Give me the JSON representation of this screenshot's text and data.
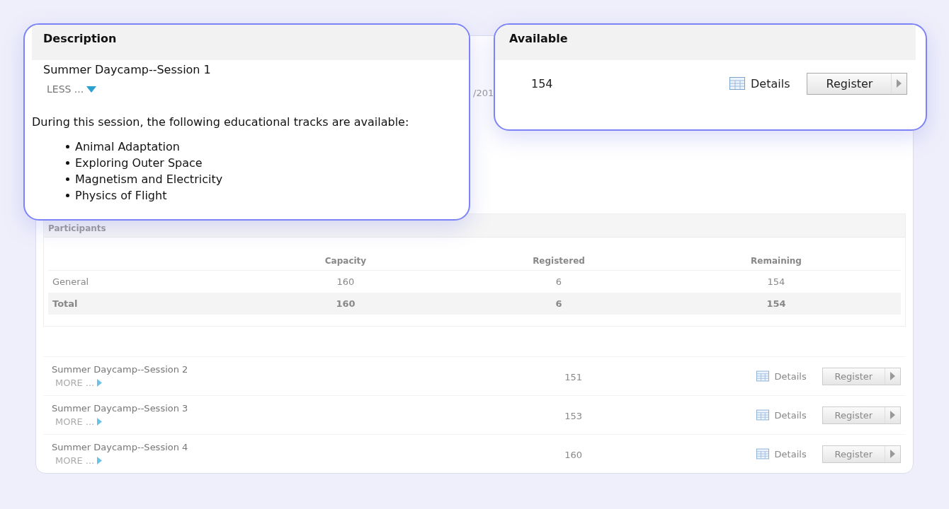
{
  "description_callout": {
    "heading": "Description",
    "title": "Summer Daycamp--Session 1",
    "toggle": "LESS ...",
    "expanded": true,
    "intro": "During this session, the following educational tracks are available:",
    "tracks": [
      "Animal Adaptation",
      "Exploring Outer Space",
      "Magnetism and Electricity",
      "Physics of Flight"
    ]
  },
  "available_callout": {
    "heading": "Available",
    "value": "154",
    "details": "Details",
    "register": "Register"
  },
  "date_fragment": "/201",
  "participants": {
    "heading": "Participants",
    "columns": [
      "Capacity",
      "Registered",
      "Remaining"
    ],
    "rows": [
      {
        "kind": "normal",
        "label": "General",
        "values": [
          "160",
          "6",
          "154"
        ]
      },
      {
        "kind": "total",
        "label": "Total",
        "values": [
          "160",
          "6",
          "154"
        ]
      }
    ]
  },
  "sessions": [
    {
      "name": "Summer Daycamp--Session 2",
      "toggle": "MORE ...",
      "expanded": false,
      "available": "151",
      "details": "Details",
      "register": "Register"
    },
    {
      "name": "Summer Daycamp--Session 3",
      "toggle": "MORE ...",
      "expanded": false,
      "available": "153",
      "details": "Details",
      "register": "Register"
    },
    {
      "name": "Summer Daycamp--Session 4",
      "toggle": "MORE ...",
      "expanded": false,
      "available": "160",
      "details": "Details",
      "register": "Register"
    }
  ]
}
